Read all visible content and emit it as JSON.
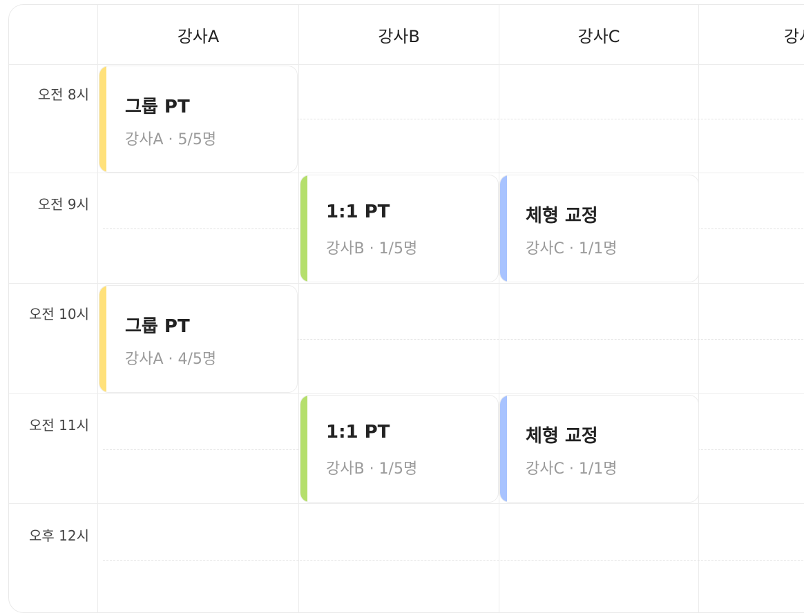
{
  "columns": [
    {
      "label": "강사A"
    },
    {
      "label": "강사B"
    },
    {
      "label": "강사C"
    },
    {
      "label": "강사"
    }
  ],
  "times": [
    {
      "label": "오전 8시"
    },
    {
      "label": "오전 9시"
    },
    {
      "label": "오전 10시"
    },
    {
      "label": "오전 11시"
    },
    {
      "label": "오후 12시"
    }
  ],
  "events": [
    {
      "title": "그룹 PT",
      "sub": "강사A · 5/5명",
      "accent": "#ffe17a"
    },
    {
      "title": "1:1 PT",
      "sub": "강사B · 1/5명",
      "accent": "#b5df6c"
    },
    {
      "title": "체형 교정",
      "sub": "강사C · 1/1명",
      "accent": "#a8c3ff"
    },
    {
      "title": "그룹 PT",
      "sub": "강사A · 4/5명",
      "accent": "#ffe17a"
    },
    {
      "title": "1:1 PT",
      "sub": "강사B · 1/5명",
      "accent": "#b5df6c"
    },
    {
      "title": "체형 교정",
      "sub": "강사C · 1/1명",
      "accent": "#a8c3ff"
    }
  ]
}
